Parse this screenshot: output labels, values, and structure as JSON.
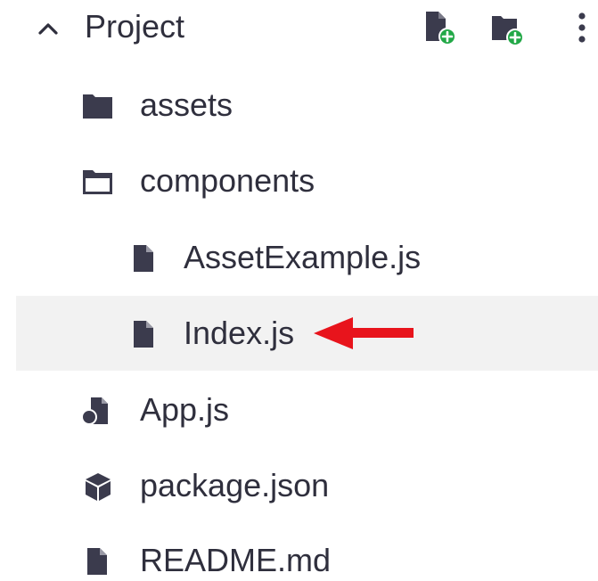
{
  "header": {
    "title": "Project",
    "toggle_icon": "chevron-up-icon",
    "new_file_icon": "file-add-icon",
    "new_folder_icon": "folder-add-icon",
    "more_icon": "more-vertical-icon"
  },
  "tree": [
    {
      "label": "assets",
      "icon": "folder-icon",
      "depth": 0
    },
    {
      "label": "components",
      "icon": "folder-open-icon",
      "depth": 0
    },
    {
      "label": "AssetExample.js",
      "icon": "file-icon",
      "depth": 1
    },
    {
      "label": "Index.js",
      "icon": "file-icon",
      "depth": 1,
      "selected": true
    },
    {
      "label": "App.js",
      "icon": "entry-file-icon",
      "depth": 0
    },
    {
      "label": "package.json",
      "icon": "package-icon",
      "depth": 0
    },
    {
      "label": "README.md",
      "icon": "file-icon",
      "depth": 0
    }
  ],
  "annotation": {
    "icon": "red-arrow-icon",
    "color": "#e8141c"
  },
  "colors": {
    "icon": "#3b3b4d",
    "text": "#2f2f3d",
    "add_badge": "#22a847",
    "selected_bg": "#f2f2f2"
  }
}
